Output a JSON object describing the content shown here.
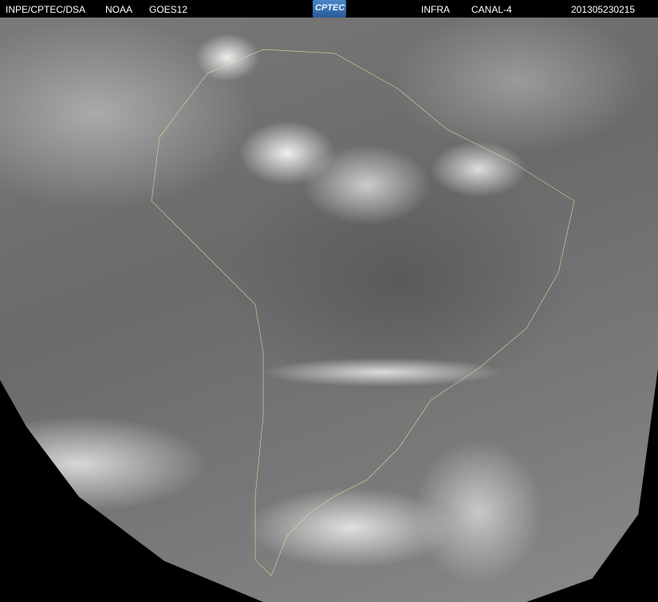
{
  "header": {
    "source": "INPE/CPTEC/DSA",
    "agency": "NOAA",
    "satellite": "GOES12",
    "logo_text": "CPTEC",
    "band": "INFRA",
    "channel": "CANAL-4",
    "timestamp": "201305230215"
  }
}
